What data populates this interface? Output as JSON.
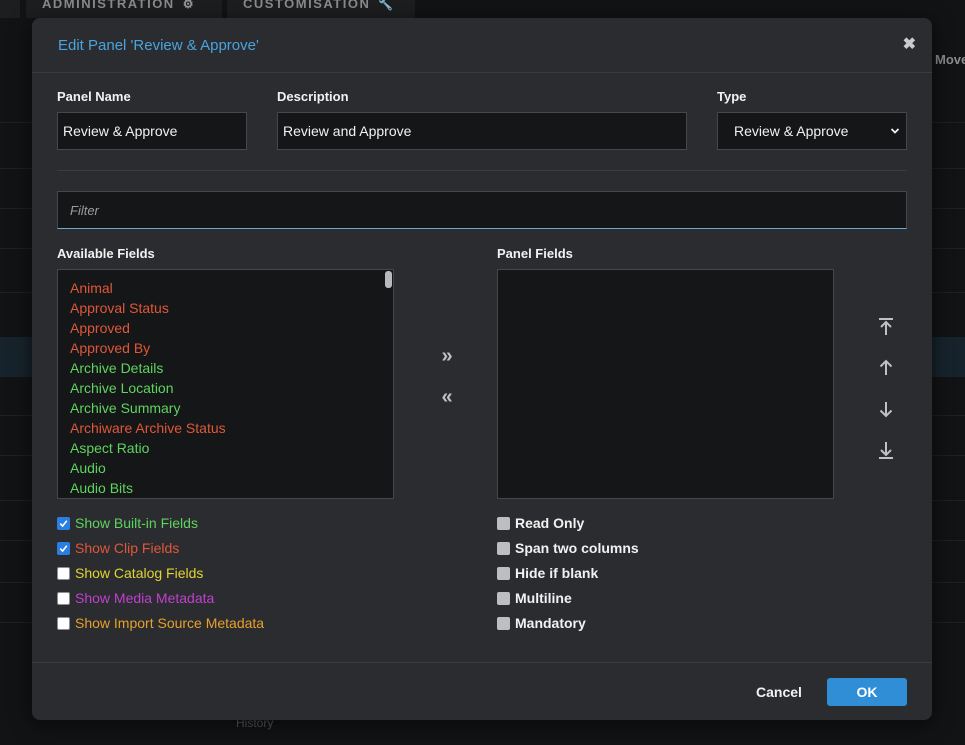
{
  "background": {
    "tabs": [
      {
        "label": "ADMINISTRATION",
        "icon": "settings-icon"
      },
      {
        "label": "CUSTOMISATION",
        "icon": "wrench-icon"
      }
    ],
    "column_header": "Move",
    "history_label": "History"
  },
  "modal": {
    "title": "Edit Panel 'Review & Approve'",
    "close_icon": "close-icon"
  },
  "form": {
    "panel_name_label": "Panel Name",
    "panel_name_value": "Review & Approve",
    "description_label": "Description",
    "description_value": "Review and Approve",
    "type_label": "Type",
    "type_value": "Review & Approve",
    "filter_placeholder": "Filter"
  },
  "available_fields": {
    "label": "Available Fields",
    "items": [
      {
        "label": "Animal",
        "kind": "clip"
      },
      {
        "label": "Approval Status",
        "kind": "clip"
      },
      {
        "label": "Approved",
        "kind": "clip"
      },
      {
        "label": "Approved By",
        "kind": "clip"
      },
      {
        "label": "Archive Details",
        "kind": "builtin"
      },
      {
        "label": "Archive Location",
        "kind": "builtin"
      },
      {
        "label": "Archive Summary",
        "kind": "builtin"
      },
      {
        "label": "Archiware Archive Status",
        "kind": "clip"
      },
      {
        "label": "Aspect Ratio",
        "kind": "builtin"
      },
      {
        "label": "Audio",
        "kind": "builtin"
      },
      {
        "label": "Audio Bits",
        "kind": "builtin"
      }
    ]
  },
  "panel_fields": {
    "label": "Panel Fields",
    "items": []
  },
  "move_buttons": {
    "add_icon": "double-chevron-right-icon",
    "remove_icon": "double-chevron-left-icon"
  },
  "order_buttons": [
    "move-top-icon",
    "move-up-icon",
    "move-down-icon",
    "move-bottom-icon"
  ],
  "filters": [
    {
      "label": "Show Built-in Fields",
      "checked": true,
      "color": "#5fd35f"
    },
    {
      "label": "Show Clip Fields",
      "checked": true,
      "color": "#e0573a"
    },
    {
      "label": "Show Catalog Fields",
      "checked": false,
      "color": "#e3d332"
    },
    {
      "label": "Show Media Metadata",
      "checked": false,
      "color": "#c040d0"
    },
    {
      "label": "Show Import Source Metadata",
      "checked": false,
      "color": "#e8a02a"
    }
  ],
  "field_options": [
    {
      "label": "Read Only",
      "checked": false
    },
    {
      "label": "Span two columns",
      "checked": false
    },
    {
      "label": "Hide if blank",
      "checked": false
    },
    {
      "label": "Multiline",
      "checked": false
    },
    {
      "label": "Mandatory",
      "checked": false
    }
  ],
  "footer": {
    "cancel_label": "Cancel",
    "ok_label": "OK"
  },
  "colors": {
    "accent": "#4aa3df",
    "ok_button": "#2f8ed6",
    "builtin_field": "#5fd35f",
    "clip_field": "#e0573a"
  }
}
